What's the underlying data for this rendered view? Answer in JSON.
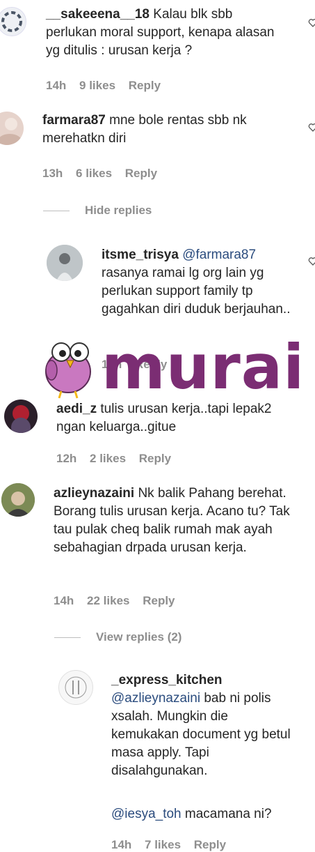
{
  "comments": [
    {
      "user": "__sakeeena__18",
      "text": "Kalau blk sbb perlukan moral support, kenapa alasan yg ditulis : urusan kerja ?",
      "time": "14h",
      "likes": "9 likes",
      "reply": "Reply"
    },
    {
      "user": "farmara87",
      "text": "mne bole rentas sbb nk merehatkn diri",
      "time": "13h",
      "likes": "6 likes",
      "reply": "Reply"
    },
    {
      "user": "itsme_trisya",
      "mention": "@farmara87",
      "text": "rasanya ramai lg org lain yg perlukan support family tp gagahkan diri duduk berjauhan..",
      "time": "14h",
      "reply": "Reply"
    },
    {
      "user": "aedi_z",
      "text": "tulis urusan kerja..tapi lepak2 ngan keluarga..gitue",
      "time": "12h",
      "likes": "2 likes",
      "reply": "Reply"
    },
    {
      "user": "azlieynazaini",
      "text": "Nk balik Pahang berehat. Borang tulis urusan kerja. Acano tu? Tak tau pulak cheq balik rumah mak ayah sebahagian drpada urusan kerja.",
      "time": "14h",
      "likes": "22 likes",
      "reply": "Reply"
    },
    {
      "user": "_express_kitchen",
      "mention": "@azlieynazaini",
      "text": "bab ni polis xsalah. Mungkin die kemukakan document yg betul masa apply. Tapi disalahgunakan.",
      "mention2": "@iesya_toh",
      "text2": "macamana ni?",
      "time": "14h",
      "likes": "7 likes",
      "reply": "Reply"
    }
  ],
  "threads": {
    "hide_replies": "Hide replies",
    "view_replies": "View replies (2)"
  },
  "watermark": {
    "brand": "murai",
    "brand_color": "#7b2d73"
  },
  "colors": {
    "text": "#262626",
    "meta": "#8e8e8e",
    "mention": "#2b4c7e"
  },
  "icons": [
    "heart-icon"
  ]
}
